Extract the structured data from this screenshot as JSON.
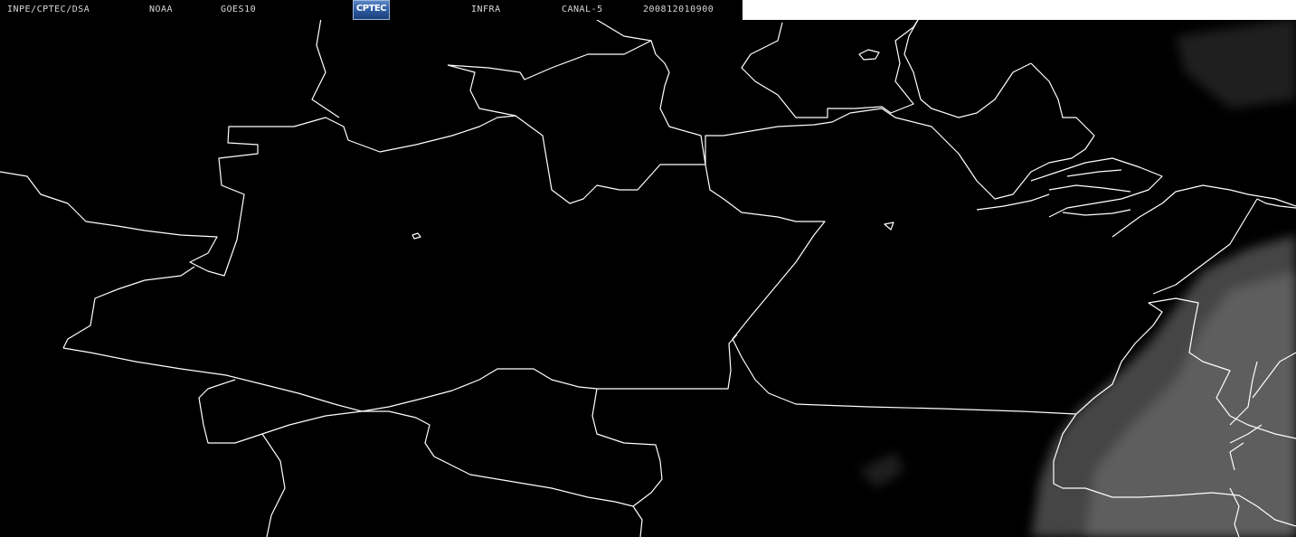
{
  "header": {
    "source": "INPE/CPTEC/DSA",
    "agency": "NOAA",
    "satellite": "GOES10",
    "logo_text": "CPTEC",
    "product": "INFRA",
    "channel": "CANAL-5",
    "timestamp": "200812010900"
  },
  "colors": {
    "background": "#000000",
    "borders": "#ffffff",
    "header_text": "#d9d9d9",
    "clouds": "#9a9a9a"
  }
}
